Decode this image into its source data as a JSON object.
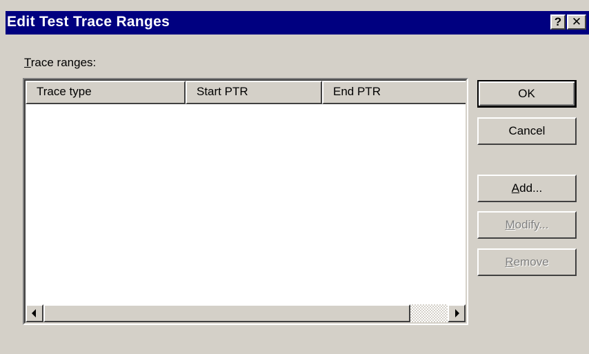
{
  "window": {
    "title": "Edit Test Trace Ranges",
    "help_glyph": "?",
    "close_glyph": "✕"
  },
  "trace_ranges": {
    "label_accel": "T",
    "label_rest": "race ranges:",
    "columns": [
      "Trace type",
      "Start PTR",
      "End PTR"
    ],
    "rows": []
  },
  "buttons": {
    "ok": "OK",
    "cancel": "Cancel",
    "add_accel": "A",
    "add_rest": "dd...",
    "modify_accel": "M",
    "modify_rest": "odify...",
    "remove_accel": "R",
    "remove_rest": "emove"
  },
  "icons": {
    "help": "question-mark-icon",
    "close": "close-icon",
    "scroll_left": "arrow-left-icon",
    "scroll_right": "arrow-right-icon"
  },
  "colors": {
    "titlebar": "#000080",
    "face": "#d4d0c8",
    "disabled_text": "#808080"
  }
}
